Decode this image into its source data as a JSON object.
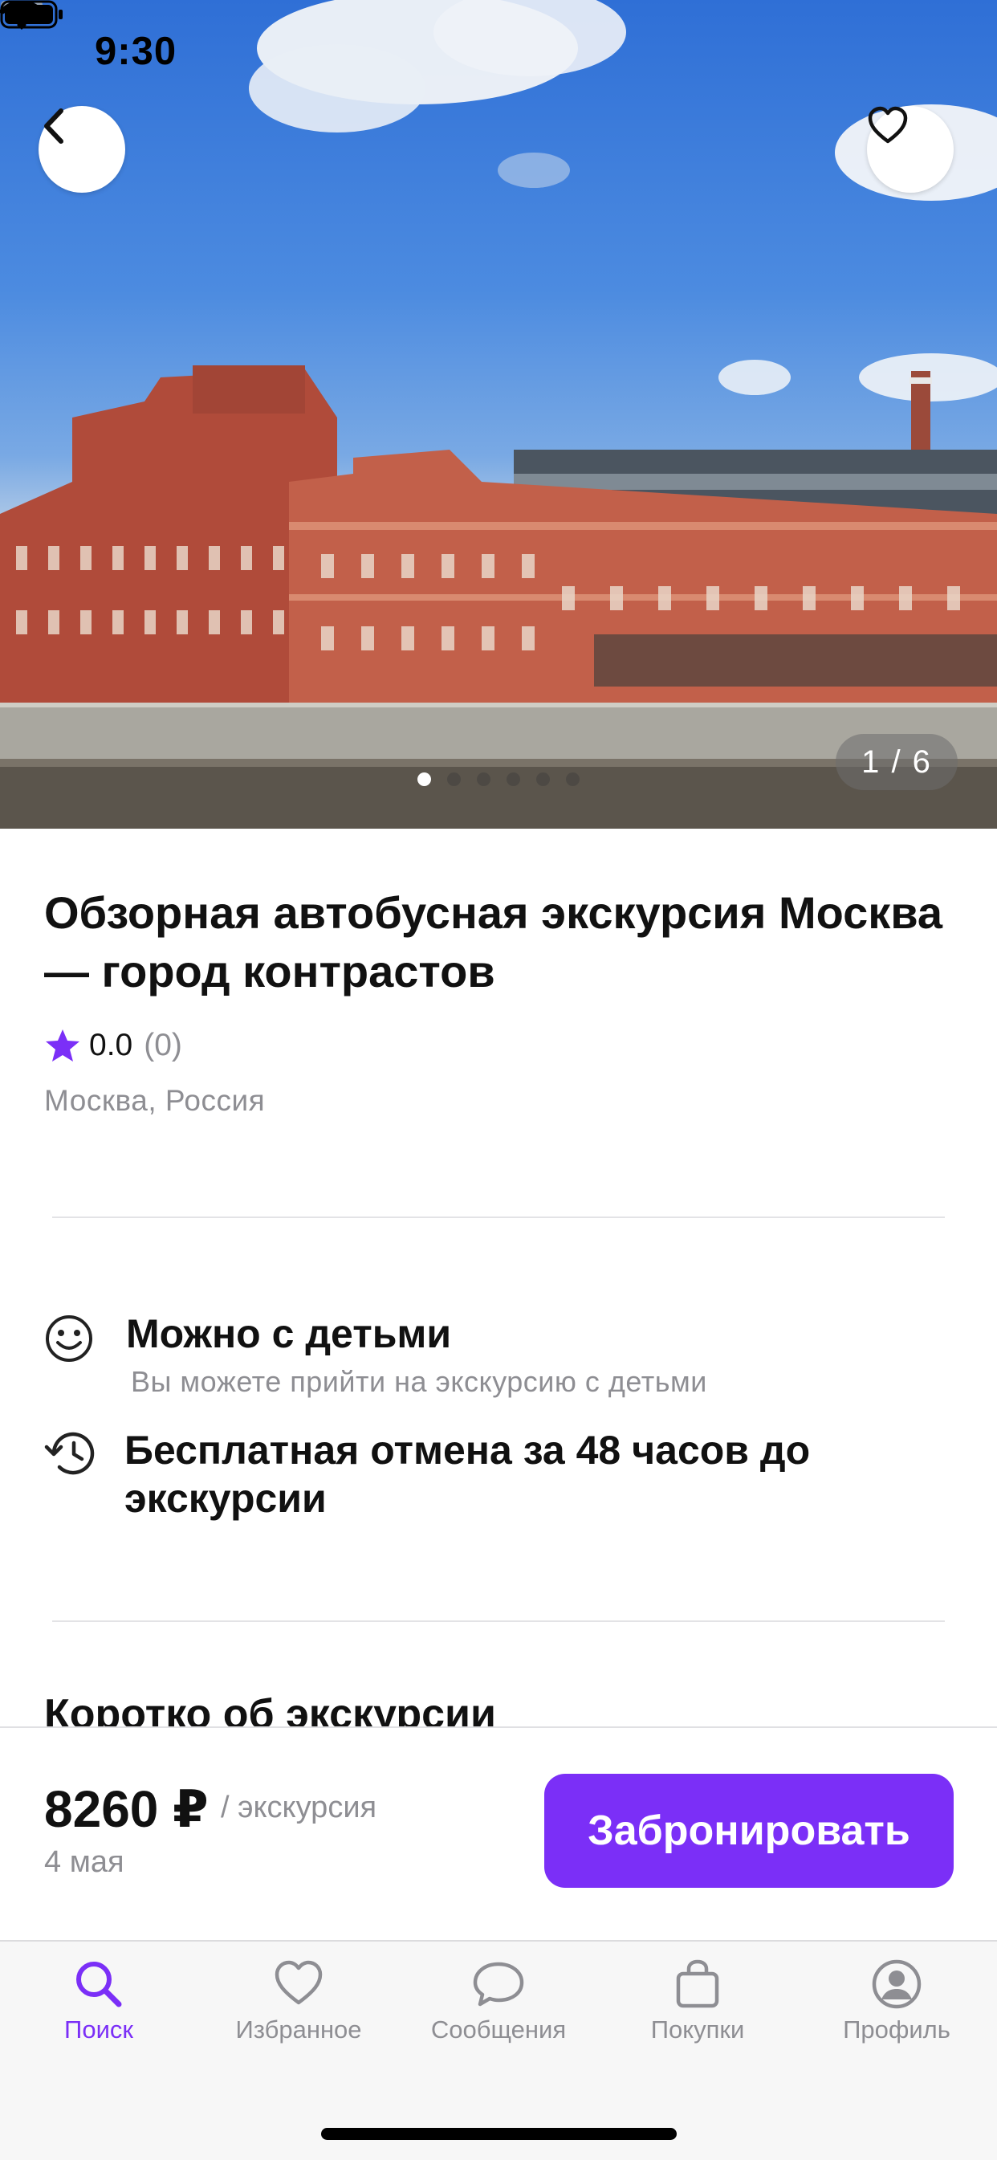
{
  "status_bar": {
    "time": "9:30"
  },
  "gallery": {
    "counter": "1 / 6",
    "total_images": 6,
    "current_index": 1
  },
  "tour": {
    "title": "Обзорная автобусная экскурсия Москва — город контрастов",
    "rating": "0.0",
    "reviews_count": "(0)",
    "location": "Москва, Россия"
  },
  "features": [
    {
      "icon": "smiley-icon",
      "title": "Можно с детьми",
      "subtitle": "Вы можете прийти на экскурсию с детьми"
    },
    {
      "icon": "history-clock-icon",
      "title": "Бесплатная отмена за 48 часов до экскурсии"
    }
  ],
  "next_section_title": "Коротко об экскурсии",
  "booking": {
    "price": "8260 ₽",
    "per_unit": "/ экскурсия",
    "date": "4 мая",
    "button_label": "Забронировать"
  },
  "tabs": [
    {
      "label": "Поиск",
      "icon": "search-icon",
      "active": true
    },
    {
      "label": "Избранное",
      "icon": "heart-icon",
      "active": false
    },
    {
      "label": "Сообщения",
      "icon": "chat-bubble-icon",
      "active": false
    },
    {
      "label": "Покупки",
      "icon": "shopping-bag-icon",
      "active": false
    },
    {
      "label": "Профиль",
      "icon": "profile-icon",
      "active": false
    }
  ],
  "colors": {
    "accent": "#7b2ff7",
    "secondary_text": "#8e8e93"
  }
}
